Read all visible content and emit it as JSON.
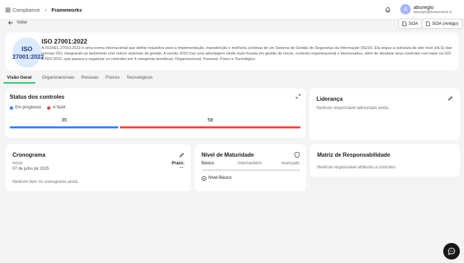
{
  "topbar": {
    "breadcrumb": [
      "Compliance",
      "Frameworks"
    ],
    "user": {
      "initial": "A",
      "name": "aburegio",
      "email": "aburegio@hunterstack.io"
    }
  },
  "subbar": {
    "back_label": "Voltar",
    "soa_label": "SOA",
    "soa_old_label": "SOA (Antigo)"
  },
  "framework": {
    "logo_line1": "ISO",
    "logo_line2": "27001:2022",
    "title": "ISO 27001:2022",
    "description": "A ISO/IEC 27001:2022 é uma norma internacional que define requisitos para a implementação, manutenção e melhoria contínua de um Sistema de Gestão de Segurança da Informação (SGSI). Ela segue a estrutura de alto nível (HLS) das normas ISO, integrando-se facilmente com outros sistemas de gestão. A versão 2022 traz uma abordagem ainda mais focada em gestão de riscos, contexto organizacional e interessados, além de atualizar seus controles com base na ISO 27002:2022, que passou a organizar os controles em 4 categorias temáticas: Organizacional, Pessoas, Físico e Tecnológico."
  },
  "tabs": [
    "Visão Geral",
    "Organizacionais",
    "Pessoas",
    "Físicos",
    "Tecnológicos"
  ],
  "active_tab": "Visão Geral",
  "status": {
    "title": "Status dos controles",
    "legend": [
      {
        "label": "Em progresso",
        "color": "#3b82f6"
      },
      {
        "label": "A fazer",
        "color": "#ef4444"
      }
    ],
    "in_progress": 35,
    "todo": 58
  },
  "lideranca": {
    "title": "Liderança",
    "empty": "Nenhum responsável adicionado ainda."
  },
  "cronograma": {
    "title": "Cronograma",
    "start_label": "Início:",
    "start_value": "07 de julho de 2025",
    "deadline_label": "Prazo:",
    "deadline_value": "—",
    "empty": "Nenhum item no cronograma ainda."
  },
  "maturidade": {
    "title": "Nível de Maturidade",
    "levels": [
      "Básico",
      "Intermediário",
      "Avançado"
    ],
    "current": "Nível Básico",
    "progress": 0
  },
  "matriz": {
    "title": "Matriz de Responsabilidade",
    "empty": "Nenhum responsável atribuído a controles."
  }
}
